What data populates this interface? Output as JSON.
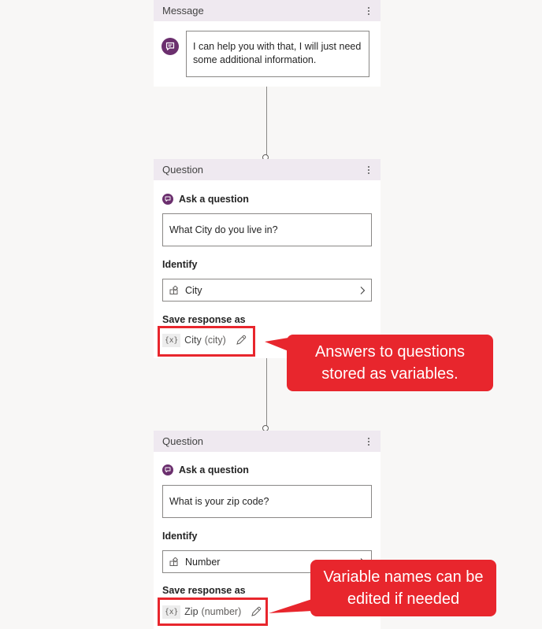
{
  "message_card": {
    "header_label": "Message",
    "text": "I can help you with that, I will just need some additional information."
  },
  "question_cards": [
    {
      "header_label": "Question",
      "ask_label": "Ask a question",
      "question_text": "What City do you live in?",
      "identify_label": "Identify",
      "entity": "City",
      "save_label": "Save response as",
      "variable_tag": "{x}",
      "variable_name": "City",
      "variable_type": "(city)"
    },
    {
      "header_label": "Question",
      "ask_label": "Ask a question",
      "question_text": "What is your zip code?",
      "identify_label": "Identify",
      "entity": "Number",
      "save_label": "Save response as",
      "variable_tag": "{x}",
      "variable_name": "Zip",
      "variable_type": "(number)"
    }
  ],
  "callouts": [
    {
      "text": "Answers to questions stored as variables."
    },
    {
      "text": "Variable names can be edited if needed"
    }
  ],
  "colors": {
    "accent_purple": "#6b2f6e",
    "header_bg": "#efe9f0",
    "highlight_red": "#e8262d",
    "canvas_bg": "#f8f7f6"
  },
  "icons": {
    "message": "chat-bubble-icon",
    "question": "question-chat-icon",
    "entity": "entity-icon",
    "more": "more-vertical-icon",
    "chevron": "chevron-right-icon",
    "edit": "pencil-icon"
  }
}
